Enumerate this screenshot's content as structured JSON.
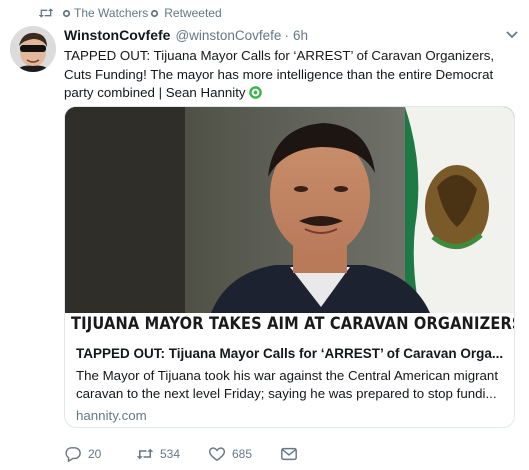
{
  "retweet_context": {
    "account": "The Watchers",
    "action": "Retweeted"
  },
  "tweet": {
    "display_name": "WinstonCovfefe",
    "handle": "@winstonCovfefe",
    "separator": "·",
    "time": "6h",
    "text": "TAPPED OUT: Tijuana Mayor Calls for ‘ARREST’ of Caravan Organizers, Cuts Funding!   The mayor has more intelligence than the entire Democrat party combined | Sean Hannity",
    "emoji": "green-circle-emoji"
  },
  "card": {
    "chyron": "TIJUANA MAYOR TAKES AIM AT CARAVAN ORGANIZERS",
    "title": "TAPPED OUT: Tijuana Mayor Calls for ‘ARREST’ of Caravan Orga...",
    "description": "The Mayor of Tijuana took his war against the Central American migrant caravan to the next level Friday; saying he was prepared to stop fundi...",
    "domain": "hannity.com"
  },
  "actions": {
    "replies": "20",
    "retweets": "534",
    "likes": "685"
  },
  "colors": {
    "text": "#14171a",
    "secondary": "#657786",
    "border": "#e1e8ed",
    "chyron_accent": "#1b4a8a"
  }
}
